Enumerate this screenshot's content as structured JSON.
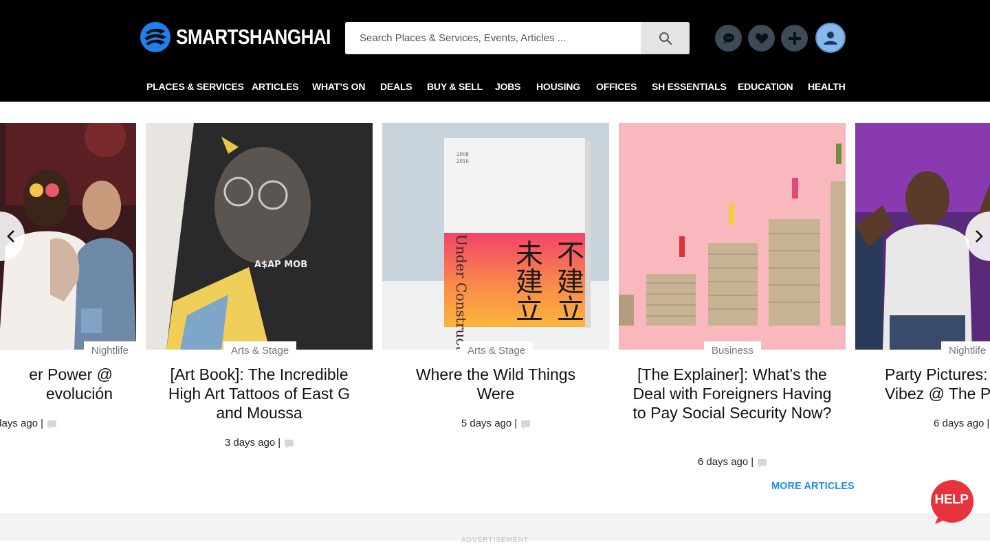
{
  "header": {
    "logo_text": "SMARTSHANGHAI",
    "search_placeholder": "Search Places & Services, Events, Articles ...",
    "icons": [
      "chat-icon",
      "heart-icon",
      "plus-icon",
      "user-icon"
    ]
  },
  "nav": [
    "PLACES & SERVICES",
    "ARTICLES",
    "WHAT’S ON",
    "DEALS",
    "BUY & SELL",
    "JOBS",
    "HOUSING",
    "OFFICES",
    "SH ESSENTIALS",
    "EDUCATION",
    "HEALTH"
  ],
  "articles": [
    {
      "category": "Nightlife",
      "title": "er Power @\nevolución",
      "time": "days ago",
      "sep": "|"
    },
    {
      "category": "Arts & Stage",
      "title": "[Art Book]: The Incredible High Art Tattoos of East G and Moussa",
      "time": "3 days ago",
      "sep": "|",
      "image_text": "A$AP MOB"
    },
    {
      "category": "Arts & Stage",
      "title": "Where the Wild Things Were",
      "time": "5 days ago",
      "sep": "|",
      "image_text": [
        "2008",
        "2016",
        "Under Construction",
        "不建立",
        "未建立"
      ]
    },
    {
      "category": "Business",
      "title": "[The Explainer]: What’s the Deal with Foreigners Having to Pay Social Security Now?",
      "time": "6 days ago",
      "sep": "|"
    },
    {
      "category": "Nightlife",
      "title": "Party Pictures:\nVibez @ The Pe",
      "time": "6 days ago",
      "sep": "|"
    }
  ],
  "more_articles": "MORE ARTICLES",
  "help": "HELP",
  "advertisement": "ADVERTISEMENT",
  "colors": {
    "accent": "#1a8cf0",
    "header_bg": "#000000",
    "help_red": "#e8323c"
  }
}
